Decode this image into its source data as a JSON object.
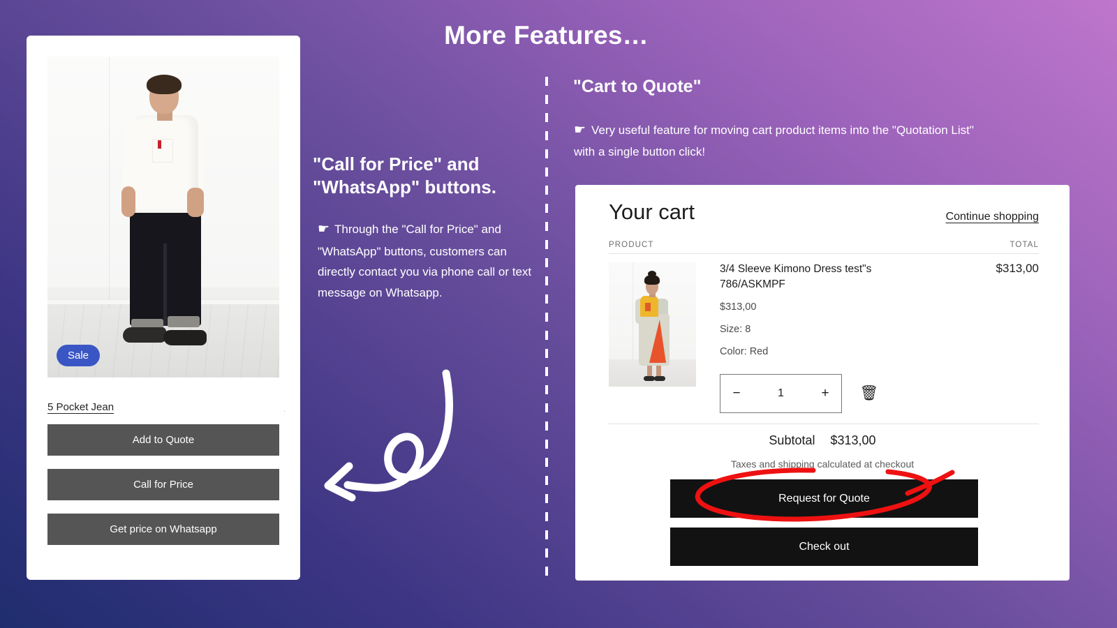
{
  "headline": "More Features…",
  "product_card": {
    "sale_badge": "Sale",
    "title": "5 Pocket Jean",
    "buttons": [
      {
        "label": "Add to Quote"
      },
      {
        "label": "Call for Price"
      },
      {
        "label": "Get price on Whatsapp"
      }
    ],
    "image_alt": "man-wearing-white-tshirt-and-dark-jeans"
  },
  "middle": {
    "heading_line1": "\"Call for Price\" and",
    "heading_line2": "\"WhatsApp\" buttons.",
    "hand_icon": "☛",
    "body": "Through the \"Call for Price\" and \"WhatsApp\" buttons, customers can directly contact you via phone call or text message on Whatsapp.",
    "arrow_icon": "curved-arrow-down-left"
  },
  "right": {
    "heading": "\"Cart to Quote\"",
    "hand_icon": "☛",
    "body": "Very useful feature for moving cart product items into the \"Quotation List\" with a single button click!"
  },
  "cart": {
    "title": "Your cart",
    "continue_shopping": "Continue shopping",
    "col_product": "PRODUCT",
    "col_total": "TOTAL",
    "item": {
      "name": "3/4 Sleeve Kimono Dress test\"s 786/ASKMPF",
      "price": "$313,00",
      "size": "Size: 8",
      "color": "Color: Red",
      "total": "$313,00",
      "qty": "1",
      "minus": "−",
      "plus": "+",
      "remove_icon": "🗑",
      "image_alt": "woman-wearing-kimono-dress"
    },
    "subtotal_label": "Subtotal",
    "subtotal_value": "$313,00",
    "tax_note": "Taxes and shipping calculated at checkout",
    "request_quote_label": "Request for Quote",
    "checkout_label": "Check out"
  },
  "annotation": {
    "highlight_color": "#ee1111",
    "target": "request-for-quote-button"
  },
  "colors": {
    "badge_blue": "#3a56c4",
    "button_gray": "#555555",
    "cta_black": "#121212",
    "bg_from": "#1f2d6e",
    "bg_to": "#be76cb"
  }
}
